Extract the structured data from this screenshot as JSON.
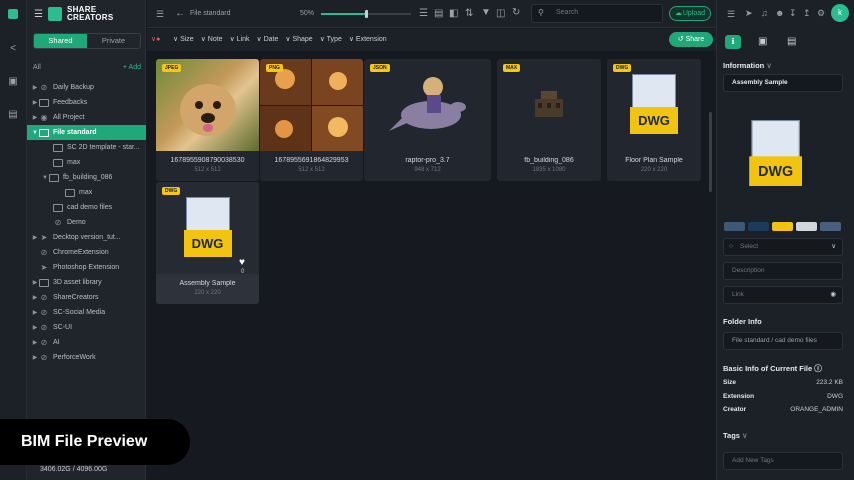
{
  "brand": {
    "line1": "SHARE",
    "line2": "CREATORS"
  },
  "sidebar": {
    "tabs": [
      "Shared",
      "Private"
    ],
    "all_label": "All",
    "add_label": "+ Add",
    "items": [
      {
        "label": "Daily Backup"
      },
      {
        "label": "Feedbacks"
      },
      {
        "label": "All Project"
      },
      {
        "label": "File standard"
      },
      {
        "label": "SC 2D template - star..."
      },
      {
        "label": "max"
      },
      {
        "label": "fb_building_086"
      },
      {
        "label": "max"
      },
      {
        "label": "cad demo files"
      },
      {
        "label": "Demo"
      },
      {
        "label": "Decktop version_tut..."
      },
      {
        "label": "ChromeExtension"
      },
      {
        "label": "Photoshop Extension"
      },
      {
        "label": "3D asset library"
      },
      {
        "label": "ShareCreators"
      },
      {
        "label": "SC-Social Media"
      },
      {
        "label": "SC-UI"
      },
      {
        "label": "AI"
      },
      {
        "label": "PerforceWork"
      }
    ],
    "storage": "3406.02G / 4096.00G"
  },
  "topbar": {
    "breadcrumb": "File standard",
    "zoom": "50%",
    "zoom_fraction": 0.5,
    "search_placeholder": "Search",
    "upload_label": "Upload"
  },
  "filters": [
    "Size",
    "Note",
    "Link",
    "Date",
    "Shape",
    "Type",
    "Extension"
  ],
  "share_label": "Share",
  "files": [
    {
      "name": "1678955908790038530",
      "size": "512 x 512",
      "tag": "JPEG"
    },
    {
      "name": "1678955691864829953",
      "size": "512 x 512",
      "tag": "PNG"
    },
    {
      "name": "raptor-pro_3.7",
      "size": "948 x 712",
      "tag": "JSON"
    },
    {
      "name": "fb_building_086",
      "size": "1835 x 1080",
      "tag": "MAX"
    },
    {
      "name": "Floor Plan Sample",
      "size": "220 x 220",
      "tag": "DWG"
    },
    {
      "name": "Assembly Sample",
      "size": "220 x 220",
      "tag": "DWG",
      "likes": "0"
    }
  ],
  "dwg_label": "DWG",
  "info": {
    "title": "Information",
    "file_name": "Assembly Sample",
    "colors": [
      "#3e5878",
      "#1b3a5c",
      "#f2c311",
      "#cfd6de",
      "#48607e"
    ],
    "select_placeholder": "Select",
    "description_placeholder": "Description",
    "link_placeholder": "Link",
    "folder_title": "Folder Info",
    "folder_path": "File standard / cad demo files",
    "basic_title": "Basic Info of Current File",
    "basic": [
      {
        "k": "Size",
        "v": "223.2 KB"
      },
      {
        "k": "Extension",
        "v": "DWG"
      },
      {
        "k": "Creator",
        "v": "ORANGE_ADMIN"
      }
    ],
    "tags_title": "Tags",
    "tags_placeholder": "Add New Tags"
  },
  "banner": "BIM File Preview",
  "avatar": "k"
}
